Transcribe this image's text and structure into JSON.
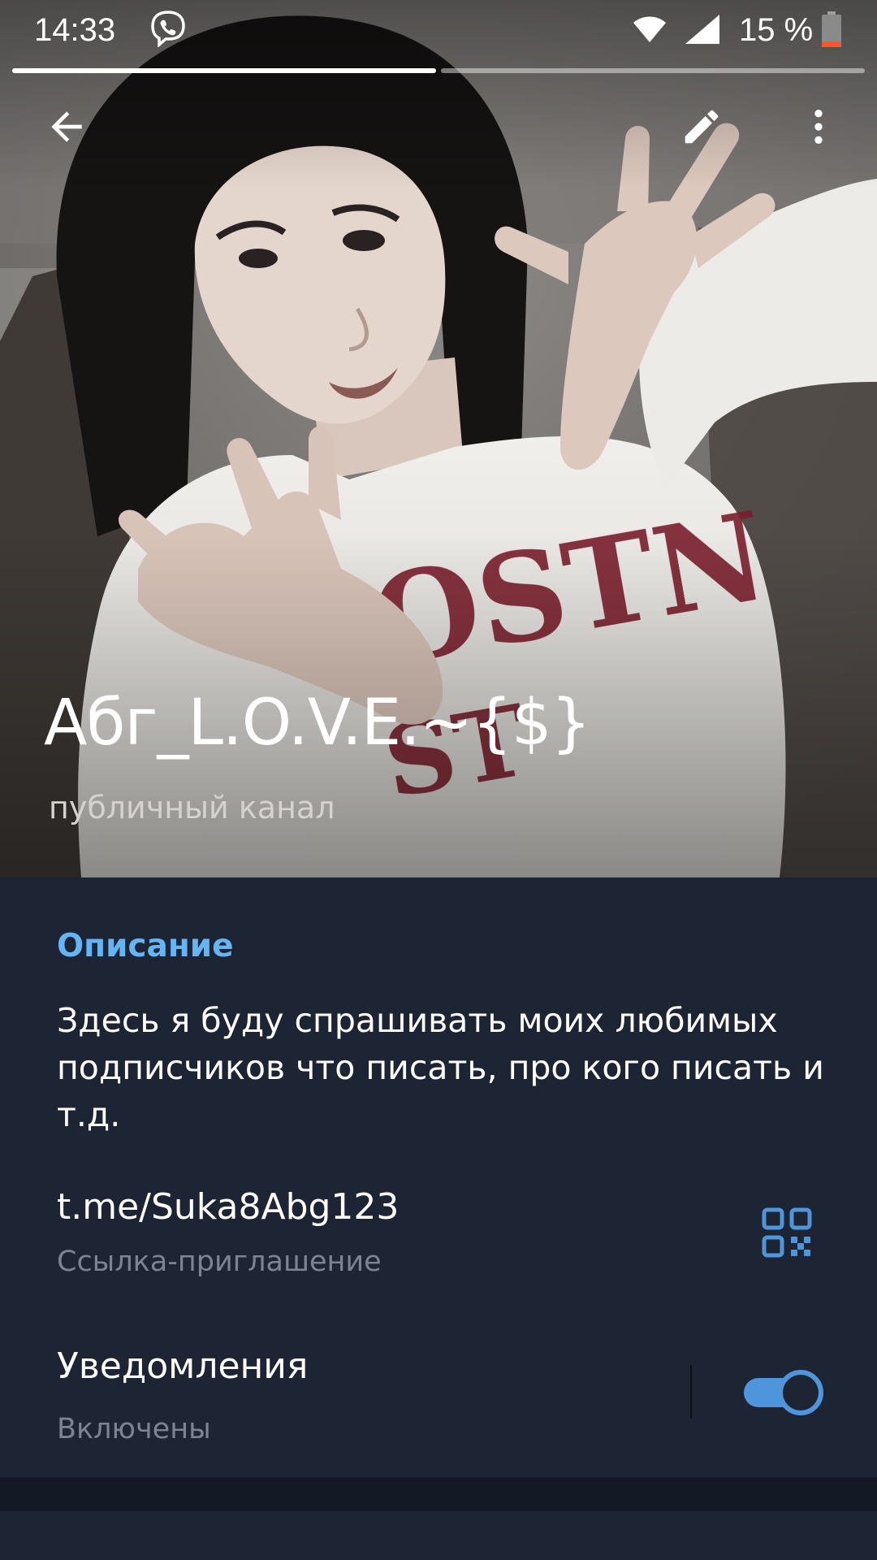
{
  "status_bar": {
    "time": "14:33",
    "battery": "15 %",
    "icons": [
      "viber-icon",
      "wifi-icon",
      "signal-icon",
      "battery-icon"
    ]
  },
  "story": {
    "segments_total": 2,
    "current_segment": 1
  },
  "toolbar": {
    "back_icon": "arrow-left-icon",
    "edit_icon": "pencil-icon",
    "more_icon": "more-vertical-icon"
  },
  "channel": {
    "title": "Абг_L.O.V.E.~{$}",
    "subtitle": "публичный канал"
  },
  "description": {
    "title": "Описание",
    "text": "Здесь я буду спрашивать моих любимых подписчиков что писать, про кого писать и т.д."
  },
  "link": {
    "value": "t.me/Suka8Abg123",
    "caption": "Ссылка-приглашение",
    "icon": "qr-code-icon"
  },
  "notifications": {
    "label": "Уведомления",
    "status": "Включены",
    "enabled": true
  },
  "colors": {
    "accent": "#64b5f6",
    "toggle": "#4f95dc",
    "panel": "#1d2434",
    "secondary_text": "#7b8492"
  }
}
